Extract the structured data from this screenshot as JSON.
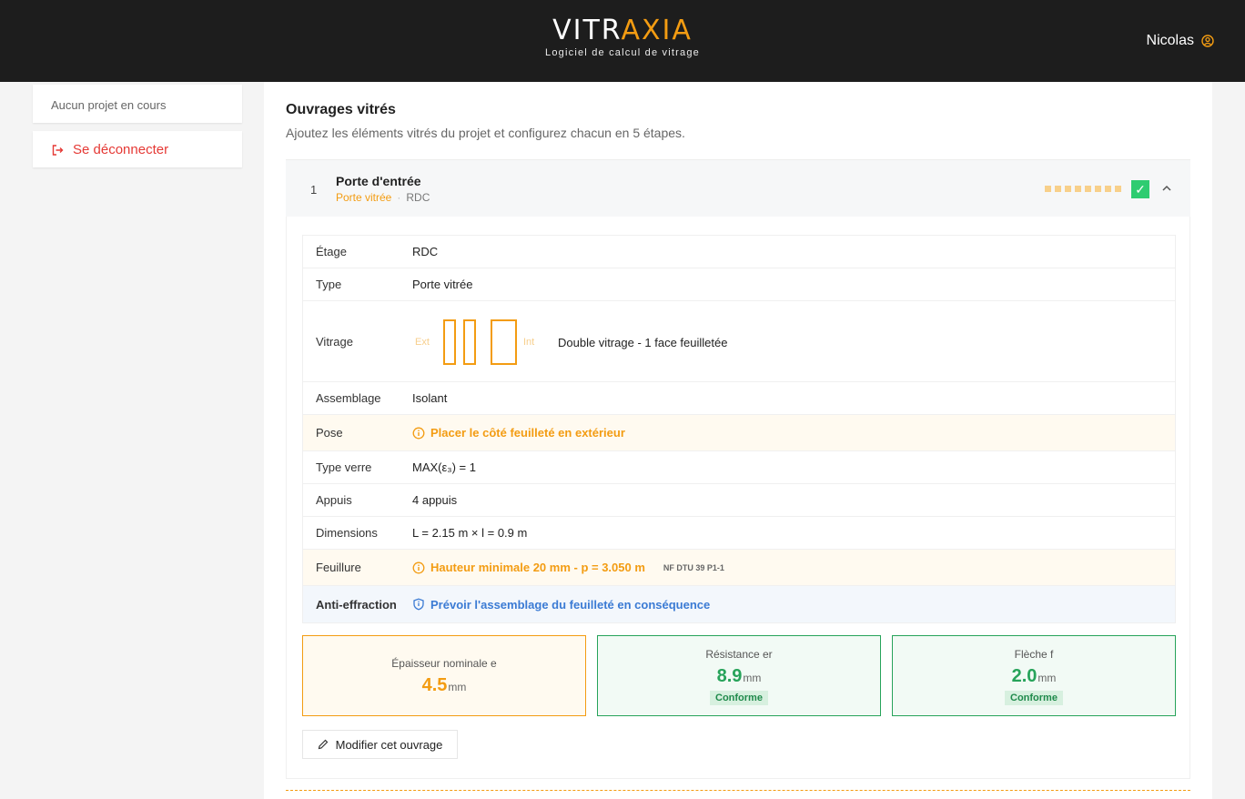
{
  "header": {
    "logo_part1": "VITR",
    "logo_part2": "AXIA",
    "tagline": "Logiciel de calcul de vitrage",
    "user_name": "Nicolas",
    "accent_color": "#f39c12"
  },
  "sidebar": {
    "project_status": "Aucun projet en cours",
    "logout_label": "Se déconnecter"
  },
  "main": {
    "title": "Ouvrages vitrés",
    "subtitle": "Ajoutez les éléments vitrés du projet et configurez chacun en 5 étapes.",
    "ouvrage": {
      "number": "1",
      "name": "Porte d'entrée",
      "type": "Porte vitrée",
      "etage": "RDC",
      "details": {
        "etage_label": "Étage",
        "etage_value": "RDC",
        "type_label": "Type",
        "type_value": "Porte vitrée",
        "vitrage_label": "Vitrage",
        "vitrage_ext": "Ext",
        "vitrage_int": "Int",
        "vitrage_value": "Double vitrage - 1 face feuilletée",
        "assemblage_label": "Assemblage",
        "assemblage_value": "Isolant",
        "pose_label": "Pose",
        "pose_value": "Placer le côté feuilleté en extérieur",
        "typeverre_label": "Type verre",
        "typeverre_value": "MAX(ε₃) = 1",
        "appuis_label": "Appuis",
        "appuis_value": "4 appuis",
        "dimensions_label": "Dimensions",
        "dimensions_value": "L = 2.15 m × l = 0.9 m",
        "feuillure_label": "Feuillure",
        "feuillure_value": "Hauteur minimale 20 mm - p = 3.050 m",
        "feuillure_norm": "NF DTU 39 P1-1",
        "antieffraction_label": "Anti-effraction",
        "antieffraction_value": "Prévoir l'assemblage du feuilleté en conséquence"
      },
      "metrics": {
        "epaisseur_label": "Épaisseur nominale e",
        "epaisseur_value": "4.5",
        "epaisseur_unit": "mm",
        "resistance_label": "Résistance er",
        "resistance_value": "8.9",
        "resistance_unit": "mm",
        "resistance_status": "Conforme",
        "fleche_label": "Flèche f",
        "fleche_value": "2.0",
        "fleche_unit": "mm",
        "fleche_status": "Conforme"
      },
      "edit_label": "Modifier cet ouvrage"
    }
  }
}
